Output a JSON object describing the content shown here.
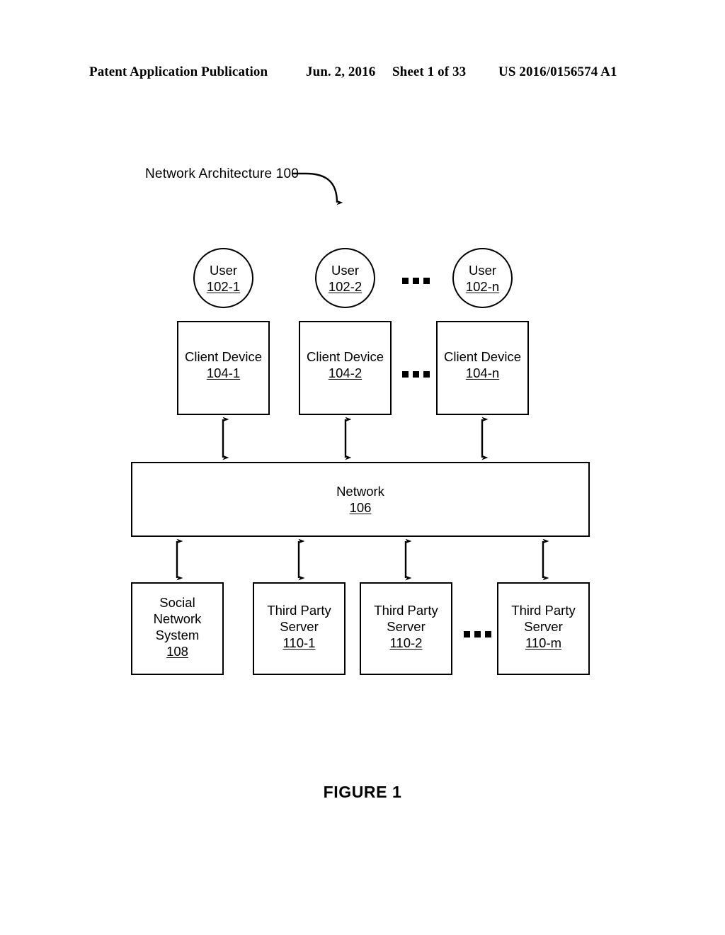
{
  "header": {
    "publication": "Patent Application Publication",
    "date": "Jun. 2, 2016",
    "sheet": "Sheet 1 of 33",
    "patent_number": "US 2016/0156574 A1"
  },
  "figure": {
    "caption": "FIGURE 1",
    "callout_label": "Network Architecture 100",
    "ellipsis_glyph": "•••"
  },
  "users": [
    {
      "title": "User",
      "ref": "102-1"
    },
    {
      "title": "User",
      "ref": "102-2"
    },
    {
      "title": "User",
      "ref": "102-n"
    }
  ],
  "client_devices": [
    {
      "title": "Client Device",
      "ref": "104-1"
    },
    {
      "title": "Client Device",
      "ref": "104-2"
    },
    {
      "title": "Client Device",
      "ref": "104-n"
    }
  ],
  "network": {
    "title": "Network",
    "ref": "106"
  },
  "backend": [
    {
      "line1": "Social",
      "line2": "Network",
      "line3": "System",
      "ref": "108"
    },
    {
      "line1": "Third Party",
      "line2": "Server",
      "ref": "110-1"
    },
    {
      "line1": "Third Party",
      "line2": "Server",
      "ref": "110-2"
    },
    {
      "line1": "Third Party",
      "line2": "Server",
      "ref": "110-m"
    }
  ],
  "colors": {
    "ink": "#000000",
    "paper": "#ffffff"
  }
}
